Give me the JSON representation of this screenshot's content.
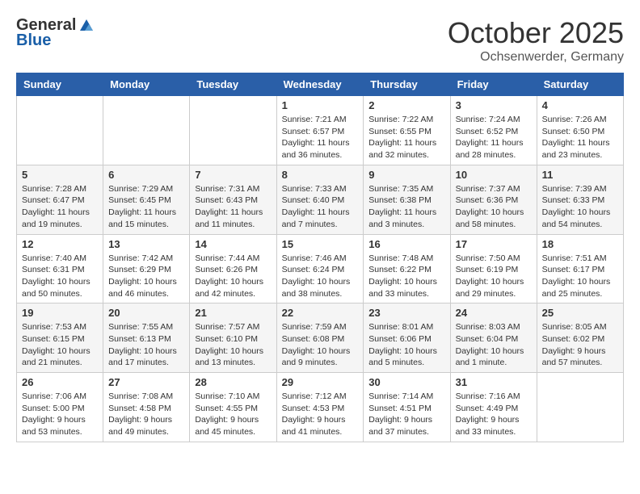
{
  "header": {
    "logo_general": "General",
    "logo_blue": "Blue",
    "month": "October 2025",
    "location": "Ochsenwerder, Germany"
  },
  "days_of_week": [
    "Sunday",
    "Monday",
    "Tuesday",
    "Wednesday",
    "Thursday",
    "Friday",
    "Saturday"
  ],
  "weeks": [
    [
      {
        "day": "",
        "info": ""
      },
      {
        "day": "",
        "info": ""
      },
      {
        "day": "",
        "info": ""
      },
      {
        "day": "1",
        "info": "Sunrise: 7:21 AM\nSunset: 6:57 PM\nDaylight: 11 hours\nand 36 minutes."
      },
      {
        "day": "2",
        "info": "Sunrise: 7:22 AM\nSunset: 6:55 PM\nDaylight: 11 hours\nand 32 minutes."
      },
      {
        "day": "3",
        "info": "Sunrise: 7:24 AM\nSunset: 6:52 PM\nDaylight: 11 hours\nand 28 minutes."
      },
      {
        "day": "4",
        "info": "Sunrise: 7:26 AM\nSunset: 6:50 PM\nDaylight: 11 hours\nand 23 minutes."
      }
    ],
    [
      {
        "day": "5",
        "info": "Sunrise: 7:28 AM\nSunset: 6:47 PM\nDaylight: 11 hours\nand 19 minutes."
      },
      {
        "day": "6",
        "info": "Sunrise: 7:29 AM\nSunset: 6:45 PM\nDaylight: 11 hours\nand 15 minutes."
      },
      {
        "day": "7",
        "info": "Sunrise: 7:31 AM\nSunset: 6:43 PM\nDaylight: 11 hours\nand 11 minutes."
      },
      {
        "day": "8",
        "info": "Sunrise: 7:33 AM\nSunset: 6:40 PM\nDaylight: 11 hours\nand 7 minutes."
      },
      {
        "day": "9",
        "info": "Sunrise: 7:35 AM\nSunset: 6:38 PM\nDaylight: 11 hours\nand 3 minutes."
      },
      {
        "day": "10",
        "info": "Sunrise: 7:37 AM\nSunset: 6:36 PM\nDaylight: 10 hours\nand 58 minutes."
      },
      {
        "day": "11",
        "info": "Sunrise: 7:39 AM\nSunset: 6:33 PM\nDaylight: 10 hours\nand 54 minutes."
      }
    ],
    [
      {
        "day": "12",
        "info": "Sunrise: 7:40 AM\nSunset: 6:31 PM\nDaylight: 10 hours\nand 50 minutes."
      },
      {
        "day": "13",
        "info": "Sunrise: 7:42 AM\nSunset: 6:29 PM\nDaylight: 10 hours\nand 46 minutes."
      },
      {
        "day": "14",
        "info": "Sunrise: 7:44 AM\nSunset: 6:26 PM\nDaylight: 10 hours\nand 42 minutes."
      },
      {
        "day": "15",
        "info": "Sunrise: 7:46 AM\nSunset: 6:24 PM\nDaylight: 10 hours\nand 38 minutes."
      },
      {
        "day": "16",
        "info": "Sunrise: 7:48 AM\nSunset: 6:22 PM\nDaylight: 10 hours\nand 33 minutes."
      },
      {
        "day": "17",
        "info": "Sunrise: 7:50 AM\nSunset: 6:19 PM\nDaylight: 10 hours\nand 29 minutes."
      },
      {
        "day": "18",
        "info": "Sunrise: 7:51 AM\nSunset: 6:17 PM\nDaylight: 10 hours\nand 25 minutes."
      }
    ],
    [
      {
        "day": "19",
        "info": "Sunrise: 7:53 AM\nSunset: 6:15 PM\nDaylight: 10 hours\nand 21 minutes."
      },
      {
        "day": "20",
        "info": "Sunrise: 7:55 AM\nSunset: 6:13 PM\nDaylight: 10 hours\nand 17 minutes."
      },
      {
        "day": "21",
        "info": "Sunrise: 7:57 AM\nSunset: 6:10 PM\nDaylight: 10 hours\nand 13 minutes."
      },
      {
        "day": "22",
        "info": "Sunrise: 7:59 AM\nSunset: 6:08 PM\nDaylight: 10 hours\nand 9 minutes."
      },
      {
        "day": "23",
        "info": "Sunrise: 8:01 AM\nSunset: 6:06 PM\nDaylight: 10 hours\nand 5 minutes."
      },
      {
        "day": "24",
        "info": "Sunrise: 8:03 AM\nSunset: 6:04 PM\nDaylight: 10 hours\nand 1 minute."
      },
      {
        "day": "25",
        "info": "Sunrise: 8:05 AM\nSunset: 6:02 PM\nDaylight: 9 hours\nand 57 minutes."
      }
    ],
    [
      {
        "day": "26",
        "info": "Sunrise: 7:06 AM\nSunset: 5:00 PM\nDaylight: 9 hours\nand 53 minutes."
      },
      {
        "day": "27",
        "info": "Sunrise: 7:08 AM\nSunset: 4:58 PM\nDaylight: 9 hours\nand 49 minutes."
      },
      {
        "day": "28",
        "info": "Sunrise: 7:10 AM\nSunset: 4:55 PM\nDaylight: 9 hours\nand 45 minutes."
      },
      {
        "day": "29",
        "info": "Sunrise: 7:12 AM\nSunset: 4:53 PM\nDaylight: 9 hours\nand 41 minutes."
      },
      {
        "day": "30",
        "info": "Sunrise: 7:14 AM\nSunset: 4:51 PM\nDaylight: 9 hours\nand 37 minutes."
      },
      {
        "day": "31",
        "info": "Sunrise: 7:16 AM\nSunset: 4:49 PM\nDaylight: 9 hours\nand 33 minutes."
      },
      {
        "day": "",
        "info": ""
      }
    ]
  ]
}
